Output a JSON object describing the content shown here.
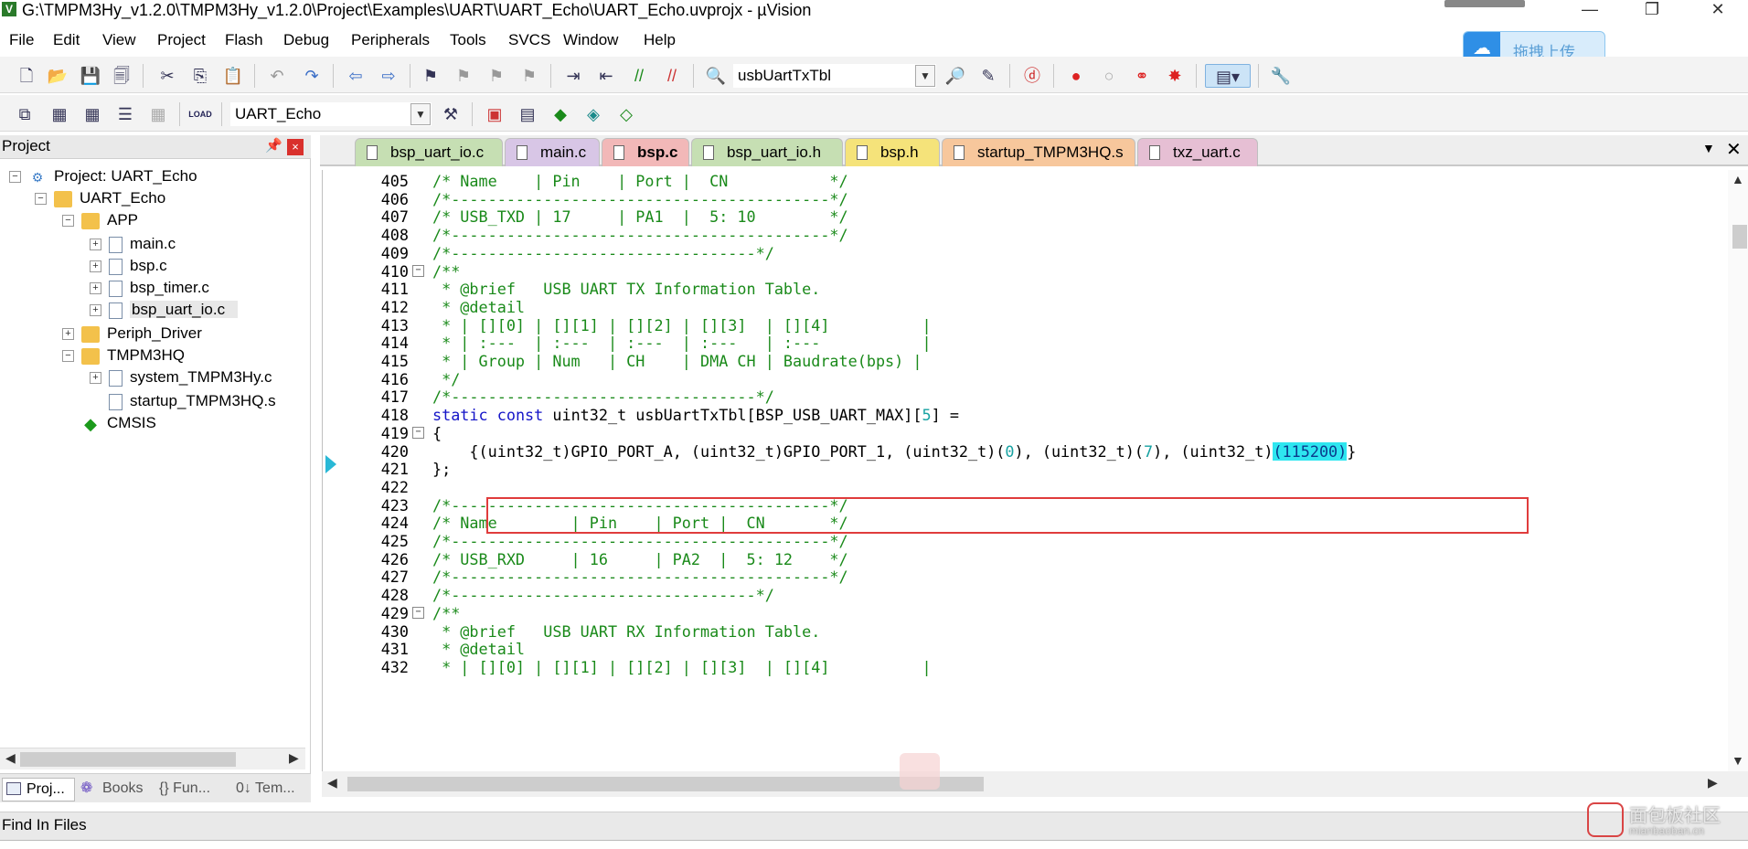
{
  "window": {
    "title": "G:\\TMPM3Hy_v1.2.0\\TMPM3Hy_v1.2.0\\Project\\Examples\\UART\\UART_Echo\\UART_Echo.uvprojx - µVision",
    "minimize": "—",
    "maximize": "❐",
    "close": "✕"
  },
  "menu": [
    "File",
    "Edit",
    "View",
    "Project",
    "Flash",
    "Debug",
    "Peripherals",
    "Tools",
    "SVCS",
    "Window",
    "Help"
  ],
  "upload": {
    "label": "拖拽上传"
  },
  "toolbar": {
    "find_combo": "usbUartTxTbl",
    "target_combo": "UART_Echo",
    "load_label": "LOAD"
  },
  "project_panel": {
    "title": "Project",
    "pin": "ᴘ",
    "close": "×",
    "tree": [
      {
        "label": "Project: UART_Echo",
        "type": "proj",
        "exp": "−"
      },
      {
        "label": "UART_Echo",
        "type": "folder",
        "exp": "−"
      },
      {
        "label": "APP",
        "type": "folder",
        "exp": "−"
      },
      {
        "label": "main.c",
        "type": "file",
        "exp": "+"
      },
      {
        "label": "bsp.c",
        "type": "file",
        "exp": "+"
      },
      {
        "label": "bsp_timer.c",
        "type": "file",
        "exp": "+"
      },
      {
        "label": "bsp_uart_io.c",
        "type": "file",
        "exp": "+"
      },
      {
        "label": "Periph_Driver",
        "type": "folder",
        "exp": "+"
      },
      {
        "label": "TMPM3HQ",
        "type": "folder",
        "exp": "−"
      },
      {
        "label": "system_TMPM3Hy.c",
        "type": "file",
        "exp": "+"
      },
      {
        "label": "startup_TMPM3HQ.s",
        "type": "file",
        "exp": ""
      },
      {
        "label": "CMSIS",
        "type": "cmsis",
        "exp": ""
      }
    ],
    "tabs": [
      "Proj...",
      "Books",
      "{} Fun...",
      "0↓ Tem..."
    ]
  },
  "editor": {
    "tabs": [
      {
        "label": "bsp_uart_io.c",
        "color": "#c6dfb3"
      },
      {
        "label": "main.c",
        "color": "#d8c6e6"
      },
      {
        "label": "bsp.c",
        "color": "#f2b8b8",
        "active": true
      },
      {
        "label": "bsp_uart_io.h",
        "color": "#c6dfb3"
      },
      {
        "label": "bsp.h",
        "color": "#f5e37a"
      },
      {
        "label": "startup_TMPM3HQ.s",
        "color": "#f7c79c"
      },
      {
        "label": "txz_uart.c",
        "color": "#e6bfd4"
      }
    ],
    "tab_menu": "▼",
    "tab_close": "✕",
    "lines": [
      {
        "n": "405",
        "t": "/* Name    | Pin    | Port |  CN           */",
        "c": "cm"
      },
      {
        "n": "406",
        "t": "/*-----------------------------------------*/",
        "c": "cm"
      },
      {
        "n": "407",
        "t": "/* USB_TXD | 17     | PA1  |  5: 10        */",
        "c": "cm"
      },
      {
        "n": "408",
        "t": "/*-----------------------------------------*/",
        "c": "cm"
      },
      {
        "n": "409",
        "t": "/*---------------------------------*/",
        "c": "cm"
      },
      {
        "n": "410",
        "t": "/**",
        "c": "cm",
        "fold": "−"
      },
      {
        "n": "411",
        "t": " * @brief   USB UART TX Information Table.",
        "c": "cm"
      },
      {
        "n": "412",
        "t": " * @detail",
        "c": "cm"
      },
      {
        "n": "413",
        "t": " * | [][0] | [][1] | [][2] | [][3]  | [][4]          |",
        "c": "cm"
      },
      {
        "n": "414",
        "t": " * | :---  | :---  | :---  | :---   | :---           |",
        "c": "cm"
      },
      {
        "n": "415",
        "t": " * | Group | Num   | CH    | DMA CH | Baudrate(bps) |",
        "c": "cm"
      },
      {
        "n": "416",
        "t": " */",
        "c": "cm",
        "fend": true
      },
      {
        "n": "417",
        "t": "/*---------------------------------*/",
        "c": "cm"
      },
      {
        "n": "418",
        "t": "static const uint32_t usbUartTxTbl[BSP_USB_UART_MAX][5] =",
        "c": "decl"
      },
      {
        "n": "419",
        "t": "{",
        "c": "plain",
        "fold": "−"
      },
      {
        "n": "420",
        "t": "    {(uint32_t)GPIO_PORT_A, (uint32_t)GPIO_PORT_1, (uint32_t)(0), (uint32_t)(7), (uint32_t)(115200)}",
        "c": "row"
      },
      {
        "n": "421",
        "t": "};",
        "c": "plain",
        "fend": true
      },
      {
        "n": "422",
        "t": "",
        "c": "plain"
      },
      {
        "n": "423",
        "t": "/*-----------------------------------------*/",
        "c": "cm"
      },
      {
        "n": "424",
        "t": "/* Name        | Pin    | Port |  CN       */",
        "c": "cm"
      },
      {
        "n": "425",
        "t": "/*-----------------------------------------*/",
        "c": "cm"
      },
      {
        "n": "426",
        "t": "/* USB_RXD     | 16     | PA2  |  5: 12    */",
        "c": "cm"
      },
      {
        "n": "427",
        "t": "/*-----------------------------------------*/",
        "c": "cm"
      },
      {
        "n": "428",
        "t": "/*---------------------------------*/",
        "c": "cm"
      },
      {
        "n": "429",
        "t": "/**",
        "c": "cm",
        "fold": "−"
      },
      {
        "n": "430",
        "t": " * @brief   USB UART RX Information Table.",
        "c": "cm"
      },
      {
        "n": "431",
        "t": " * @detail",
        "c": "cm"
      },
      {
        "n": "432",
        "t": " * | [][0] | [][1] | [][2] | [][3]  | [][4]          |",
        "c": "cm"
      }
    ],
    "decl": {
      "kw1": "static",
      "kw2": "const",
      "rest": " uint32_t usbUartTxTbl[BSP_USB_UART_MAX][",
      "num": "5",
      "end": "] ="
    },
    "row": {
      "indent": "    {",
      "p1": "(uint32_t)GPIO_PORT_A, (uint32_t)GPIO_PORT_1, (uint32_t)(",
      "n1": "0",
      "p2": "), (uint32_t)(",
      "n2": "7",
      "p3": "), (uint32_t)",
      "hl": "(115200)",
      "close": "}"
    }
  },
  "find_panel": {
    "title": "Find In Files"
  },
  "watermark": {
    "text": "面包板社区",
    "sub": "mianbaoban.cn"
  }
}
